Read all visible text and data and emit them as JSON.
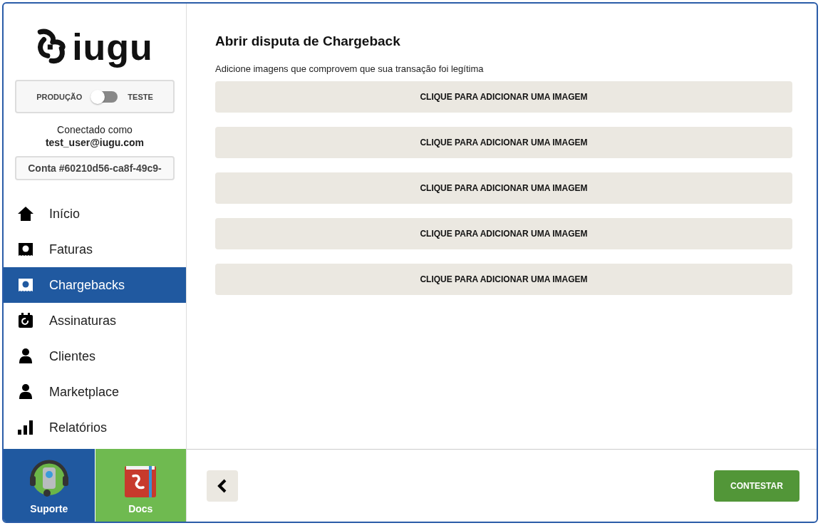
{
  "sidebar": {
    "logo": "iugu",
    "environment": {
      "left_label": "PRODUÇÃO",
      "right_label": "TESTE",
      "on": false
    },
    "connected_label": "Conectado como",
    "user": "test_user@iugu.com",
    "account": "Conta #60210d56-ca8f-49c9-",
    "items": [
      {
        "kind": "home",
        "label": "Início",
        "selected": false
      },
      {
        "kind": "invoice",
        "label": "Faturas",
        "selected": false
      },
      {
        "kind": "invoice",
        "label": "Chargebacks",
        "selected": true
      },
      {
        "kind": "calendar",
        "label": "Assinaturas",
        "selected": false
      },
      {
        "kind": "person",
        "label": "Clientes",
        "selected": false
      },
      {
        "kind": "person",
        "label": "Marketplace",
        "selected": false
      },
      {
        "kind": "bars",
        "label": "Relatórios",
        "selected": false
      }
    ],
    "tiles": [
      {
        "kind": "support",
        "label": "Suporte"
      },
      {
        "kind": "docs",
        "label": "Docs"
      }
    ]
  },
  "main": {
    "title": "Abrir disputa de Chargeback",
    "subtitle": "Adicione imagens que comprovem que sua transação foi legítima",
    "uploads": [
      "CLIQUE PARA ADICIONAR UMA IMAGEM",
      "CLIQUE PARA ADICIONAR UMA IMAGEM",
      "CLIQUE PARA ADICIONAR UMA IMAGEM",
      "CLIQUE PARA ADICIONAR UMA IMAGEM",
      "CLIQUE PARA ADICIONAR UMA IMAGEM"
    ],
    "submit": "CONTESTAR"
  }
}
